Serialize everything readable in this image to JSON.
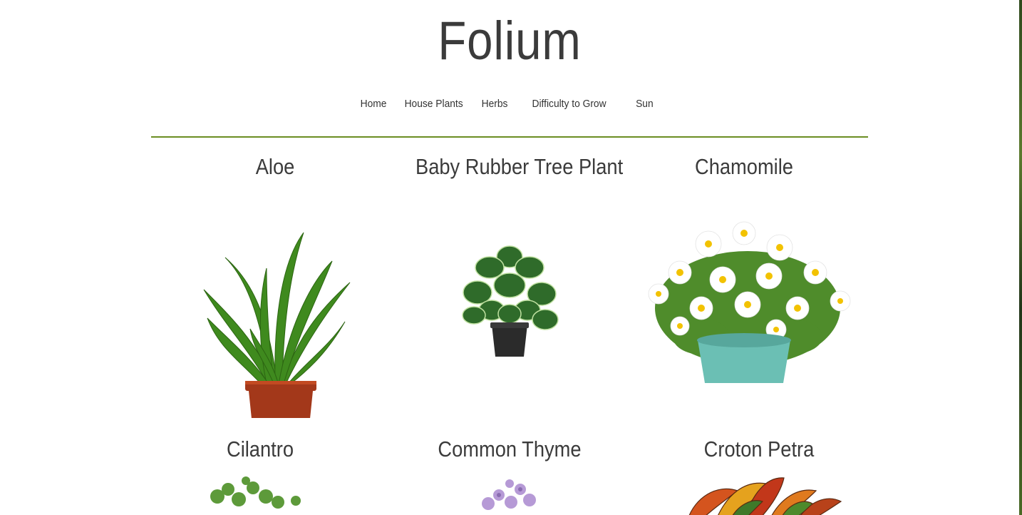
{
  "site": {
    "title": "Folium"
  },
  "nav": {
    "items": [
      "Home",
      "House Plants",
      "Herbs",
      "Difficulty to Grow",
      "Sun"
    ]
  },
  "colors": {
    "accent": "#6b8e23",
    "text": "#3b3b3b"
  },
  "plants": [
    {
      "name": "Aloe",
      "image": "aloe-plant-image"
    },
    {
      "name": "Baby Rubber Tree Plant",
      "image": "rubber-tree-plant-image"
    },
    {
      "name": "Chamomile",
      "image": "chamomile-plant-image"
    },
    {
      "name": "Cilantro",
      "image": "cilantro-plant-image"
    },
    {
      "name": "Common Thyme",
      "image": "thyme-plant-image"
    },
    {
      "name": "Croton Petra",
      "image": "croton-plant-image"
    }
  ]
}
